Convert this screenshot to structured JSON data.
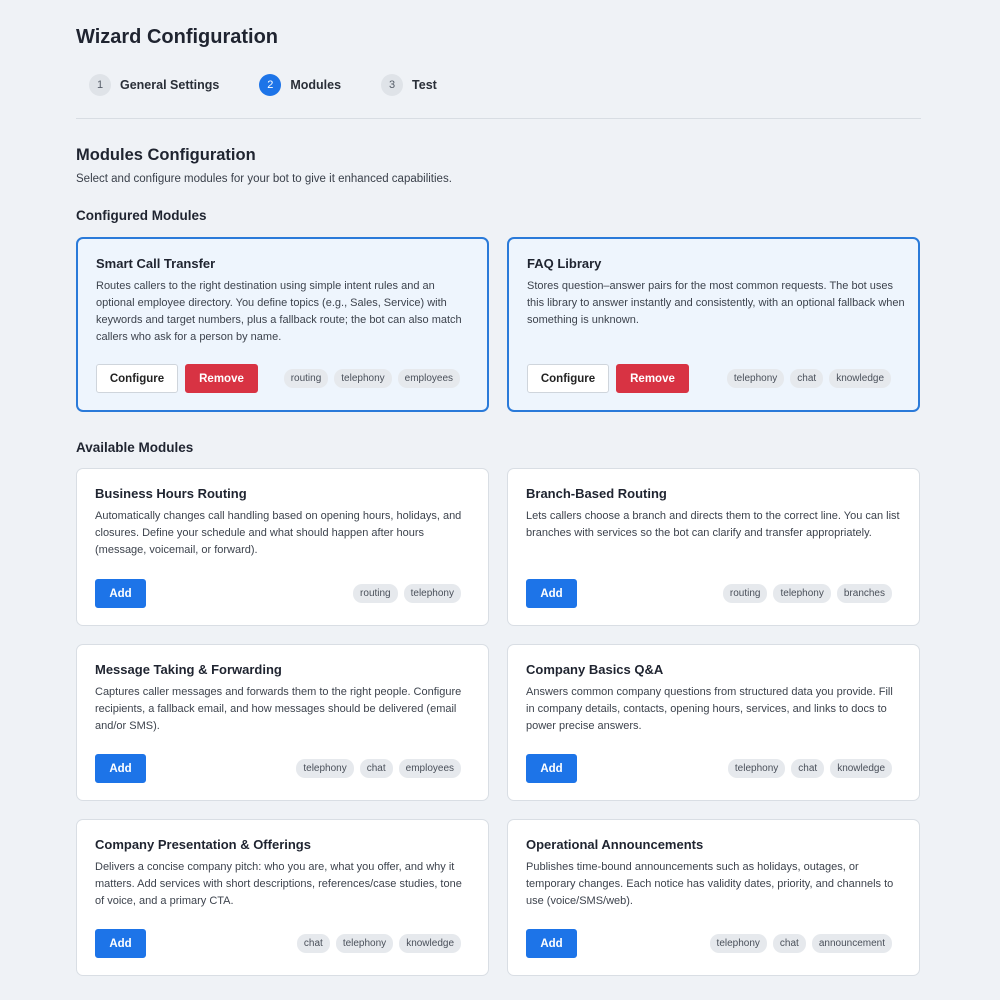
{
  "page_title": "Wizard Configuration",
  "stepper": [
    {
      "num": "1",
      "label": "General Settings"
    },
    {
      "num": "2",
      "label": "Modules"
    },
    {
      "num": "3",
      "label": "Test"
    }
  ],
  "active_step": "Modules",
  "section": {
    "title": "Modules Configuration",
    "subtitle": "Select and configure modules for your bot to give it enhanced capabilities."
  },
  "configured": {
    "title": "Configured Modules",
    "configure_label": "Configure",
    "remove_label": "Remove",
    "modules": [
      {
        "title": "Smart Call Transfer",
        "description": "Routes callers to the right destination using simple intent rules and an optional employee directory. You define topics (e.g., Sales, Service) with keywords and target numbers, plus a fallback route; the bot can also match callers who ask for a person by name.",
        "tags": [
          "routing",
          "telephony",
          "employees"
        ]
      },
      {
        "title": "FAQ Library",
        "description": "Stores question–answer pairs for the most common requests. The bot uses this library to answer instantly and consistently, with an optional fallback when something is unknown.",
        "tags": [
          "telephony",
          "chat",
          "knowledge"
        ]
      }
    ]
  },
  "available": {
    "title": "Available Modules",
    "add_label": "Add",
    "modules": [
      {
        "title": "Business Hours Routing",
        "description": "Automatically changes call handling based on opening hours, holidays, and closures. Define your schedule and what should happen after hours (message, voicemail, or forward).",
        "tags": [
          "routing",
          "telephony"
        ]
      },
      {
        "title": "Branch-Based Routing",
        "description": "Lets callers choose a branch and directs them to the correct line. You can list branches with services so the bot can clarify and transfer appropriately.",
        "tags": [
          "routing",
          "telephony",
          "branches"
        ]
      },
      {
        "title": "Message Taking & Forwarding",
        "description": "Captures caller messages and forwards them to the right people. Configure recipients, a fallback email, and how messages should be delivered (email and/or SMS).",
        "tags": [
          "telephony",
          "chat",
          "employees"
        ]
      },
      {
        "title": "Company Basics Q&A",
        "description": "Answers common company questions from structured data you provide. Fill in company details, contacts, opening hours, services, and links to docs to power precise answers.",
        "tags": [
          "telephony",
          "chat",
          "knowledge"
        ]
      },
      {
        "title": "Company Presentation & Offerings",
        "description": "Delivers a concise company pitch: who you are, what you offer, and why it matters. Add services with short descriptions, references/case studies, tone of voice, and a primary CTA.",
        "tags": [
          "chat",
          "telephony",
          "knowledge"
        ]
      },
      {
        "title": "Operational Announcements",
        "description": "Publishes time-bound announcements such as holidays, outages, or temporary changes. Each notice has validity dates, priority, and channels to use (voice/SMS/web).",
        "tags": [
          "telephony",
          "chat",
          "announcement"
        ]
      }
    ]
  },
  "colors": {
    "accent": "#1d74e8",
    "danger": "#d83343",
    "configured_border": "#2a7ad9",
    "configured_bg": "#eef5fd",
    "page_bg": "#eff2f6"
  }
}
